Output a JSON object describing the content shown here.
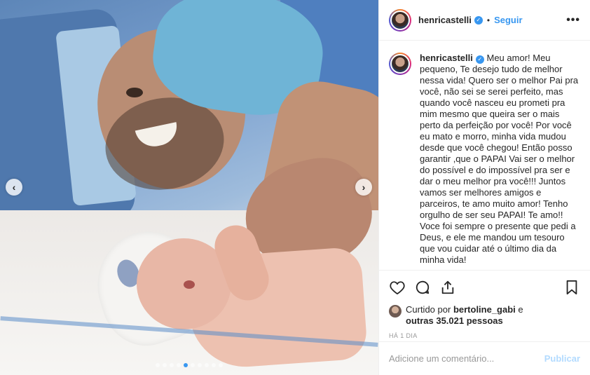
{
  "post": {
    "username": "henricastelli",
    "follow_label": "Seguir",
    "separator": "•",
    "more_label": "•••",
    "caption": "Meu amor! Meu pequeno, Te desejo tudo de melhor nessa vida! Quero ser o melhor Pai pra você, não sei se serei perfeito, mas quando você nasceu eu prometi pra mim mesmo que queira ser o mais perto da perfeição por você! Por você eu mato e morro, minha vida mudou desde que você chegou! Então posso garantir ,que o PAPAI Vai ser o melhor do possível e do impossível pra ser e dar o meu melhor pra você!!! Juntos vamos ser melhores amigos e parceiros, te amo muito amor! Tenho orgulho de ser seu PAPAI! Te amo!! Voce foi sempre o presente que pedi a Deus, e ele me mandou um tesouro que vou cuidar até o último dia da minha vida!",
    "likes": {
      "prefix": "Curtido por",
      "liker": "bertoline_gabi",
      "joiner": "e",
      "others": "outras 35.021 pessoas"
    },
    "time": "HÁ 1 DIA"
  },
  "comment_box": {
    "placeholder": "Adicione um comentário...",
    "publish_label": "Publicar"
  },
  "carousel": {
    "prev_label": "‹",
    "next_label": "›",
    "slide_count": 10,
    "active_index": 4
  },
  "icons": {
    "verified": "verified-badge-icon",
    "like": "heart-icon",
    "comment": "comment-bubble-icon",
    "share": "share-icon",
    "save": "bookmark-icon"
  },
  "colors": {
    "link_blue": "#3897f0",
    "publish_disabled": "#b3dbff",
    "text": "#262626",
    "muted": "#999999"
  }
}
